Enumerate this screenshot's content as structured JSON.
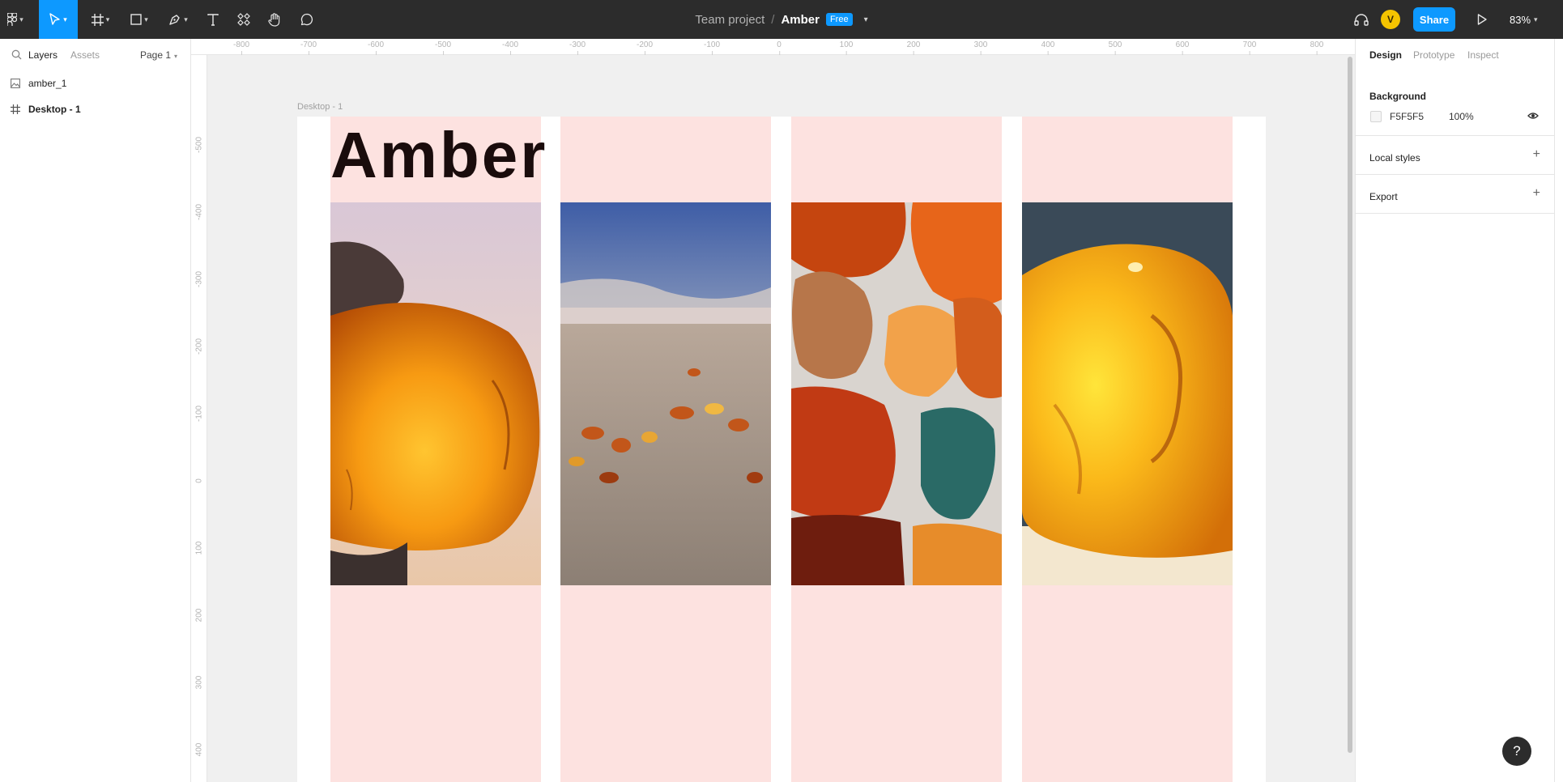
{
  "toolbar": {
    "tools": [
      {
        "name": "main-menu",
        "icon": "figma-logo-icon"
      },
      {
        "name": "move-tool",
        "icon": "cursor-icon",
        "active": true
      },
      {
        "name": "frame-tool",
        "icon": "frame-hash-icon"
      },
      {
        "name": "shape-tool",
        "icon": "rectangle-icon"
      },
      {
        "name": "pen-tool",
        "icon": "pen-icon"
      },
      {
        "name": "text-tool",
        "icon": "text-icon"
      },
      {
        "name": "resources-tool",
        "icon": "components-icon"
      },
      {
        "name": "hand-tool",
        "icon": "hand-icon"
      },
      {
        "name": "comment-tool",
        "icon": "comment-icon"
      }
    ],
    "breadcrumb_team": "Team project",
    "breadcrumb_sep": "/",
    "file_name": "Amber",
    "plan_badge": "Free",
    "avatar_initial": "V",
    "share_label": "Share",
    "zoom": "83%",
    "accent_color": "#0d99ff"
  },
  "left_panel": {
    "tab_layers": "Layers",
    "tab_assets": "Assets",
    "page_selector": "Page 1",
    "layers": [
      {
        "name": "amber_1",
        "icon": "image-icon"
      },
      {
        "name": "Desktop - 1",
        "icon": "frame-hash-icon"
      }
    ]
  },
  "canvas": {
    "frame_label": "Desktop - 1",
    "title_text": "Amber",
    "column_color": "#fde2e0",
    "ruler_x": [
      "-800",
      "-700",
      "-600",
      "-500",
      "-400",
      "-300",
      "-200",
      "-100",
      "0",
      "100",
      "200",
      "300",
      "400",
      "500",
      "600",
      "700",
      "800"
    ],
    "ruler_y": [
      "-500",
      "-400",
      "-300",
      "-200",
      "-100",
      "0",
      "100",
      "200",
      "300",
      "400"
    ],
    "photos": [
      "amber-stone-in-hand",
      "amber-on-beach",
      "amber-pebbles-closeup",
      "amber-chunk-macro"
    ]
  },
  "right_panel": {
    "tab_design": "Design",
    "tab_prototype": "Prototype",
    "tab_inspect": "Inspect",
    "background_label": "Background",
    "background_hex": "F5F5F5",
    "background_opacity": "100%",
    "local_styles_label": "Local styles",
    "export_label": "Export"
  },
  "help_label": "?"
}
